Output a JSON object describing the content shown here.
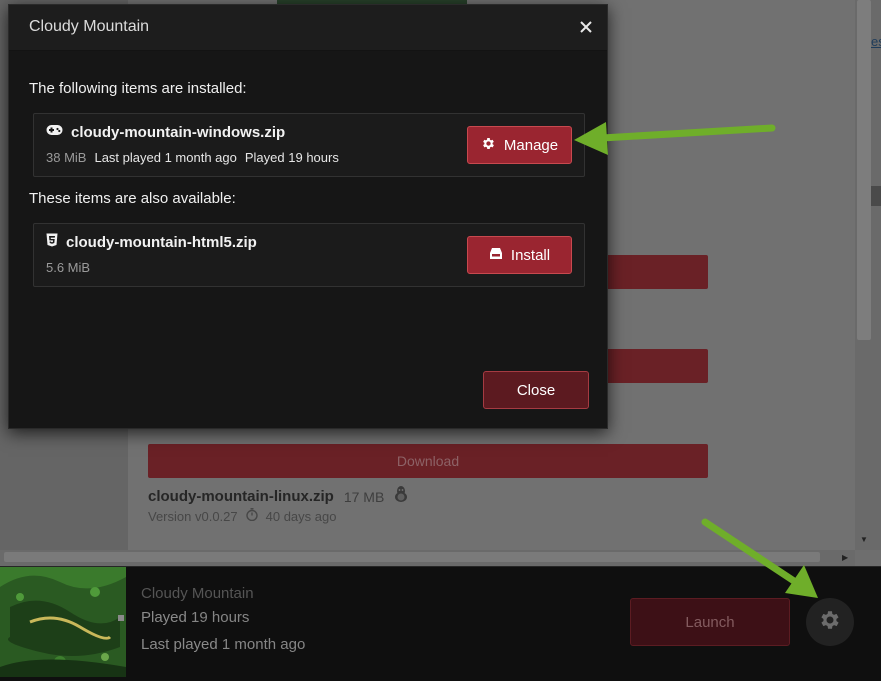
{
  "colors": {
    "accent_red": "#9a2530",
    "annotation_green": "#6fae2a",
    "modal_bg": "#161616"
  },
  "background": {
    "side_link": "es",
    "download_label": "Download",
    "file_name": "cloudy-mountain-linux.zip",
    "file_size": "17 MB",
    "file_platform_icon": "linux-icon",
    "version": "Version v0.0.27",
    "age": "40 days ago"
  },
  "bottom": {
    "game_title": "Cloudy Mountain",
    "played_label": "Played",
    "played_value": "19 hours",
    "last_played_label": "Last played",
    "last_played_value": "1 month ago",
    "launch_label": "Launch",
    "gear_icon": "gear-icon"
  },
  "modal": {
    "title": "Cloudy Mountain",
    "close_icon": "close-icon",
    "installed_heading": "The following items are installed:",
    "available_heading": "These items are also available:",
    "installed_items": [
      {
        "icon": "gamepad-icon",
        "name": "cloudy-mountain-windows.zip",
        "size": "38 MiB",
        "last_played_label": "Last played",
        "last_played_value": "1 month ago",
        "played_label": "Played",
        "played_value": "19 hours",
        "button_icon": "gear-icon",
        "button_label": "Manage"
      }
    ],
    "available_items": [
      {
        "icon": "html5-icon",
        "name": "cloudy-mountain-html5.zip",
        "size": "5.6 MiB",
        "button_icon": "install-icon",
        "button_label": "Install"
      }
    ],
    "close_label": "Close"
  }
}
